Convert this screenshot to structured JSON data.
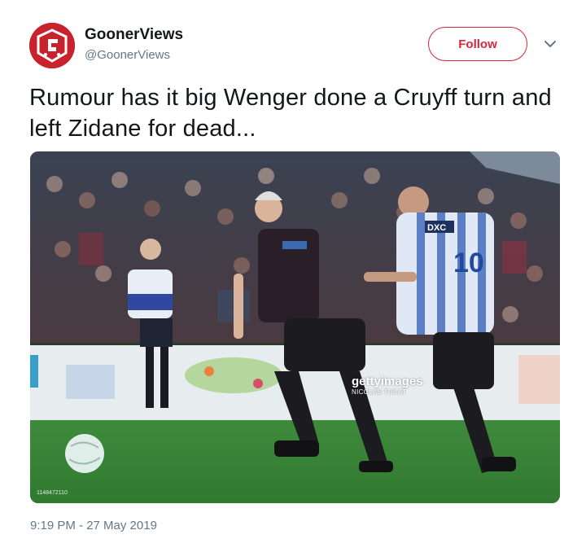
{
  "account": {
    "display_name": "GoonerViews",
    "handle": "@GoonerViews",
    "avatar_icon": "gooner-views-logo"
  },
  "follow_button": {
    "label": "Follow"
  },
  "menu_icon": "chevron-down-icon",
  "tweet": {
    "text": "Rumour has it big Wenger done a Cruyff turn and left Zidane for dead...",
    "timestamp": "9:19 PM - 27 May 2019"
  },
  "media": {
    "watermark_brand": "gettyimages",
    "watermark_credit": "NICOLAS TUCAT",
    "shirt_number": "10",
    "sponsor": "DXC",
    "photo_id": "1148472110"
  },
  "colors": {
    "accent": "#d7263d",
    "avatar_bg": "#c8232c",
    "text_secondary": "#657786"
  }
}
